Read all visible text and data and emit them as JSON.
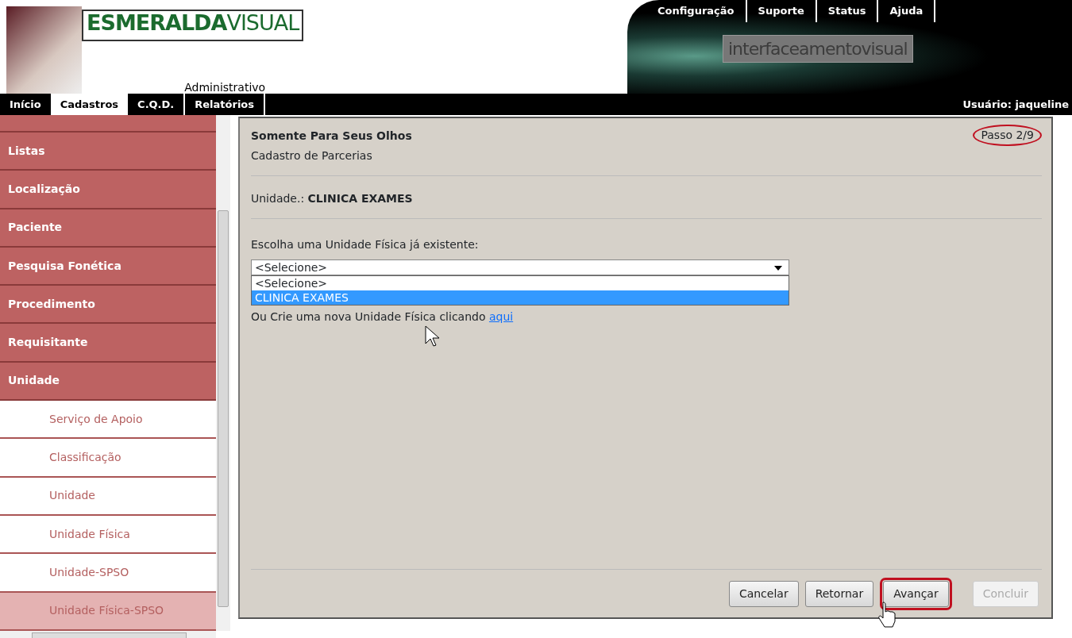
{
  "header": {
    "logo_bold": "ESMERALDA",
    "logo_light": "VISUAL",
    "module": "Administrativo",
    "banner_text": "interfaceamentovisual",
    "top_links": [
      "Configuração",
      "Suporte",
      "Status",
      "Ajuda"
    ]
  },
  "nav": {
    "tabs": [
      {
        "label": "Início",
        "selected": false
      },
      {
        "label": "Cadastros",
        "selected": true
      },
      {
        "label": "C.Q.D.",
        "selected": false
      },
      {
        "label": "Relatórios",
        "selected": false
      }
    ],
    "user": "Usuário: jaqueline"
  },
  "sidebar": {
    "items": [
      {
        "label": "Listas",
        "kind": "category",
        "selected": false
      },
      {
        "label": "Localização",
        "kind": "category",
        "selected": false
      },
      {
        "label": "Paciente",
        "kind": "category",
        "selected": false
      },
      {
        "label": "Pesquisa Fonética",
        "kind": "category",
        "selected": false
      },
      {
        "label": "Procedimento",
        "kind": "category",
        "selected": false
      },
      {
        "label": "Requisitante",
        "kind": "category",
        "selected": false
      },
      {
        "label": "Unidade",
        "kind": "category",
        "selected": false
      },
      {
        "label": "Serviço de Apoio",
        "kind": "sub",
        "selected": false
      },
      {
        "label": "Classificação",
        "kind": "sub",
        "selected": false
      },
      {
        "label": "Unidade",
        "kind": "sub",
        "selected": false
      },
      {
        "label": "Unidade Física",
        "kind": "sub",
        "selected": false
      },
      {
        "label": "Unidade-SPSO",
        "kind": "sub",
        "selected": false
      },
      {
        "label": "Unidade Física-SPSO",
        "kind": "sub",
        "selected": true
      }
    ]
  },
  "panel": {
    "title": "Somente Para Seus Olhos",
    "subtitle": "Cadastro de Parcerias",
    "step": "Passo 2/9",
    "step_circled": true,
    "unit_label": "Unidade.:",
    "unit_value": "CLINICA EXAMES",
    "choose_label": "Escolha uma Unidade Física já existente:",
    "select": {
      "value": "<Selecione>",
      "expanded": true,
      "options": [
        {
          "label": "<Selecione>",
          "highlighted": false
        },
        {
          "label": "CLINICA EXAMES",
          "highlighted": true
        }
      ]
    },
    "create_text": "Ou Crie uma nova Unidade Física clicando",
    "create_link": "aqui",
    "buttons": [
      {
        "label": "Cancelar",
        "disabled": false,
        "highlighted": false
      },
      {
        "label": "Retornar",
        "disabled": false,
        "highlighted": false
      },
      {
        "label": "Avançar",
        "disabled": false,
        "highlighted": true
      },
      {
        "label": "Concluir",
        "disabled": true,
        "highlighted": false
      }
    ]
  }
}
